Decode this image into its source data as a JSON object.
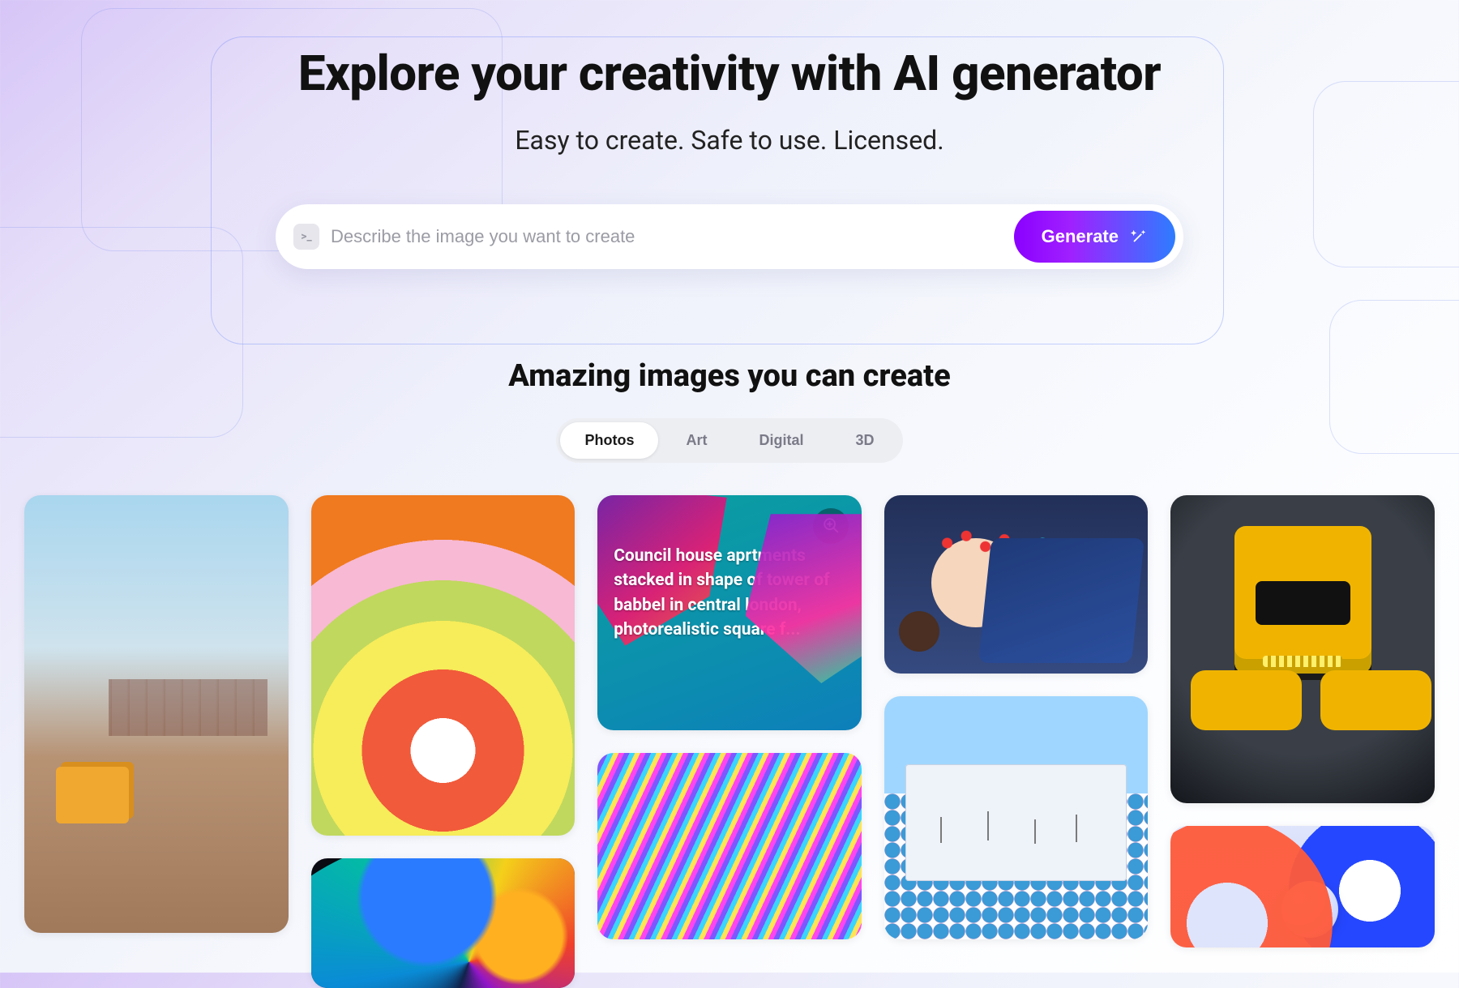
{
  "hero": {
    "title": "Explore your creativity with AI generator",
    "subtitle": "Easy to create. Safe to use. Licensed."
  },
  "search": {
    "placeholder": "Describe the image you want to create",
    "button_label": "Generate",
    "prompt_icon_glyph": ">_"
  },
  "gallery": {
    "heading": "Amazing images you can create",
    "tabs": [
      "Photos",
      "Art",
      "Digital",
      "3D"
    ],
    "active_tab_index": 0,
    "hover_caption": "Council house aprtments stacked in shape of tower of babbel in central london, photorealistic square f..."
  }
}
